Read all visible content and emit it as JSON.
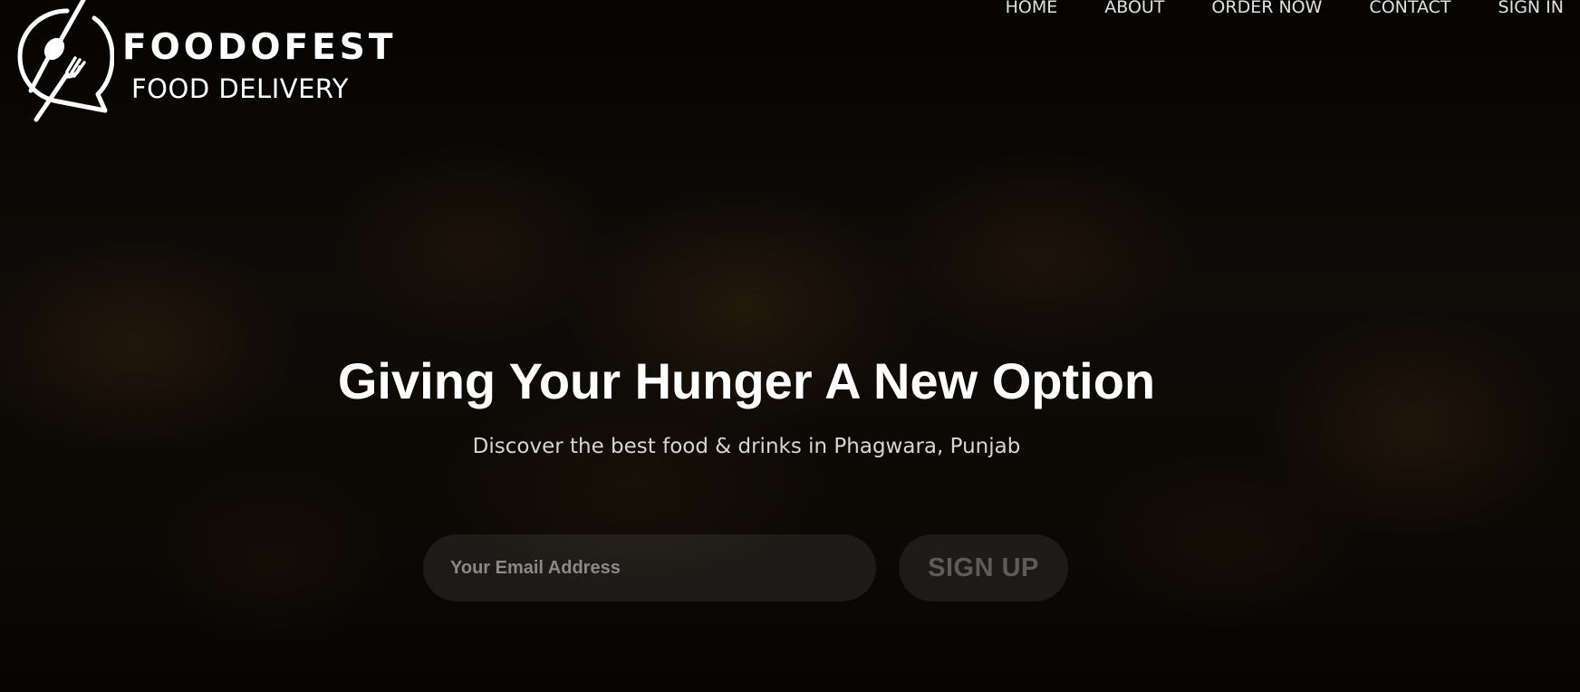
{
  "brand": {
    "name": "FOODOFEST",
    "tagline": "FOOD DELIVERY",
    "logo_icon": "spoon-fork-speech-bubble-icon"
  },
  "nav": {
    "items": [
      {
        "label": "HOME"
      },
      {
        "label": "ABOUT"
      },
      {
        "label": "ORDER NOW"
      },
      {
        "label": "CONTACT"
      },
      {
        "label": "SIGN IN"
      }
    ]
  },
  "hero": {
    "headline": "Giving Your Hunger A New Option",
    "subheadline": "Discover the best food & drinks in Phagwara, Punjab",
    "email_placeholder": "Your Email Address",
    "email_value": "",
    "signup_label": "SIGN UP"
  },
  "colors": {
    "text_primary": "#ffffff",
    "text_muted": "#d6d6d6",
    "background": "#0c0906",
    "control_fill": "rgba(255,255,255,0.08)"
  }
}
